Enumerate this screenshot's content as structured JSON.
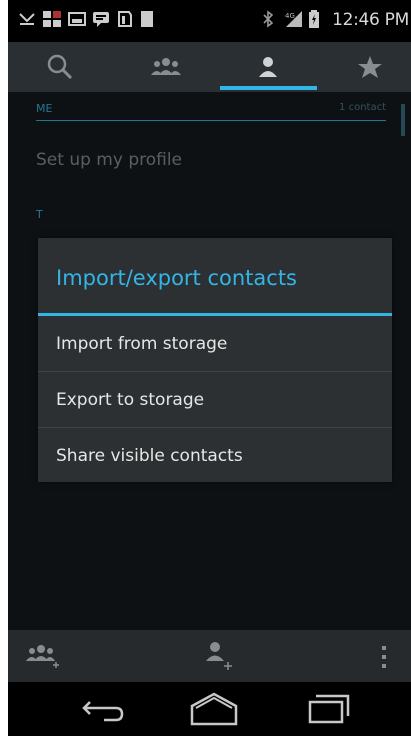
{
  "status_bar": {
    "time": "12:46 PM",
    "icons": [
      "missed-call-icon",
      "bbm-icon",
      "image-icon",
      "message-icon",
      "download-icon",
      "storage-icon",
      "bluetooth-icon",
      "signal-icon",
      "battery-icon"
    ]
  },
  "tabs": [
    {
      "name": "search",
      "icon": "search-icon"
    },
    {
      "name": "groups",
      "icon": "groups-icon"
    },
    {
      "name": "contacts",
      "icon": "person-icon",
      "selected": true
    },
    {
      "name": "favorites",
      "icon": "star-icon"
    }
  ],
  "list": {
    "me_header": "ME",
    "me_count": "1 contact",
    "profile_label": "Set up my profile",
    "t_header": "T"
  },
  "dialog": {
    "title": "Import/export contacts",
    "items": [
      {
        "label": "Import from storage"
      },
      {
        "label": "Export to storage"
      },
      {
        "label": "Share visible contacts"
      }
    ]
  },
  "action_bar": {
    "add_group": "add-group-icon",
    "add_contact": "add-contact-icon",
    "overflow": "overflow-menu-icon"
  },
  "nav_bar": [
    "back-icon",
    "home-icon",
    "recents-icon"
  ],
  "colors": {
    "accent": "#33b5e5",
    "background": "#161b1f"
  }
}
